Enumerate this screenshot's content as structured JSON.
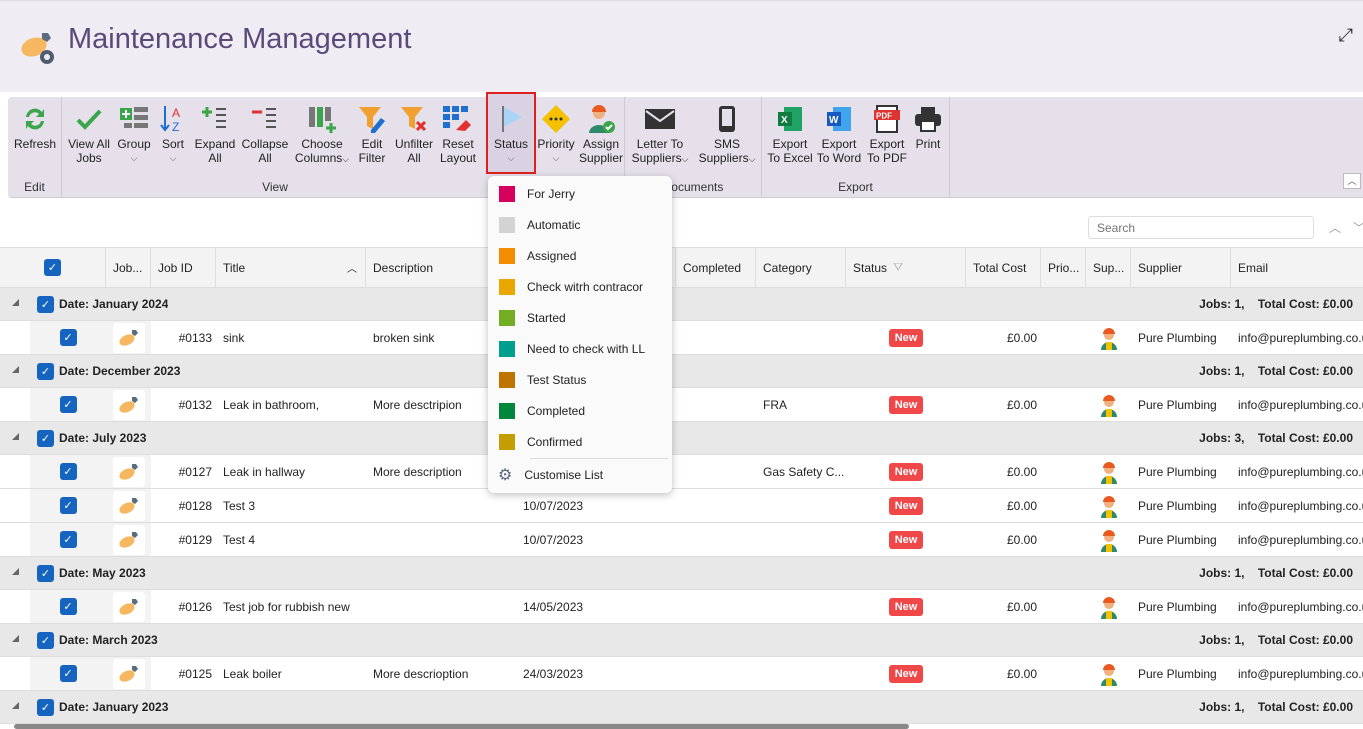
{
  "app": {
    "title": "Maintenance Management"
  },
  "ribbon": {
    "groups": {
      "edit": "Edit",
      "view": "View",
      "documents": "Documents",
      "export": "Export"
    },
    "buttons": {
      "refresh": "Refresh",
      "view_all": [
        "View All",
        "Jobs"
      ],
      "group": "Group",
      "sort": "Sort",
      "expand_all": [
        "Expand",
        "All"
      ],
      "collapse_all": [
        "Collapse",
        "All"
      ],
      "choose_columns": [
        "Choose",
        "Columns"
      ],
      "edit_filter": [
        "Edit",
        "Filter"
      ],
      "unfilter_all": [
        "Unfilter",
        "All"
      ],
      "reset_layout": [
        "Reset",
        "Layout"
      ],
      "status": "Status",
      "priority": "Priority",
      "assign_supplier": [
        "Assign",
        "Supplier"
      ],
      "letter": [
        "Letter To",
        "Suppliers"
      ],
      "sms": [
        "SMS",
        "Suppliers"
      ],
      "excel": [
        "Export",
        "To Excel"
      ],
      "word": [
        "Export",
        "To Word"
      ],
      "pdf": [
        "Export",
        "To PDF"
      ],
      "print": "Print"
    }
  },
  "search": {
    "placeholder": "Search"
  },
  "status_menu": {
    "items": [
      {
        "label": "For Jerry",
        "color": "#d6005f"
      },
      {
        "label": "Automatic",
        "color": "#d3d3d3"
      },
      {
        "label": "Assigned",
        "color": "#f28c00"
      },
      {
        "label": "Check witrh contracor",
        "color": "#e9a700"
      },
      {
        "label": "Started",
        "color": "#73ad24"
      },
      {
        "label": "Need to check with LL",
        "color": "#009e8c"
      },
      {
        "label": "Test Status",
        "color": "#bf7400"
      },
      {
        "label": "Completed",
        "color": "#00873c"
      },
      {
        "label": "Confirmed",
        "color": "#c49d00"
      }
    ],
    "customise": "Customise List"
  },
  "columns": {
    "job_icon": "Job...",
    "job_id": "Job ID",
    "title": "Title",
    "description": "Description",
    "completed": "Completed",
    "category": "Category",
    "status": "Status",
    "total_cost": "Total Cost",
    "priority": "Prio...",
    "supplier_icon": "Sup...",
    "supplier": "Supplier",
    "email": "Email"
  },
  "groups": [
    {
      "label": "Date: January 2024",
      "summary": "Jobs: 1,    Total Cost: £0.00",
      "rows": [
        {
          "id": "#0133",
          "title": "sink",
          "description": "broken sink",
          "date": "",
          "category": "",
          "status": "New",
          "cost": "£0.00",
          "supplier": "Pure Plumbing",
          "email": "info@pureplumbing.co.uk"
        }
      ]
    },
    {
      "label": "Date: December 2023",
      "summary": "Jobs: 1,    Total Cost: £0.00",
      "rows": [
        {
          "id": "#0132",
          "title": "Leak in bathroom,",
          "description": "More desctripion",
          "date": "",
          "category": "FRA",
          "status": "New",
          "cost": "£0.00",
          "supplier": "Pure Plumbing",
          "email": "info@pureplumbing.co.uk"
        }
      ]
    },
    {
      "label": "Date: July 2023",
      "summary": "Jobs: 3,    Total Cost: £0.00",
      "rows": [
        {
          "id": "#0127",
          "title": "Leak in hallway",
          "description": "More description",
          "date": "",
          "category": "Gas Safety C...",
          "status": "New",
          "cost": "£0.00",
          "supplier": "Pure Plumbing",
          "email": "info@pureplumbing.co.uk"
        },
        {
          "id": "#0128",
          "title": "Test 3",
          "description": "",
          "date": "10/07/2023",
          "category": "",
          "status": "New",
          "cost": "£0.00",
          "supplier": "Pure Plumbing",
          "email": "info@pureplumbing.co.uk"
        },
        {
          "id": "#0129",
          "title": "Test 4",
          "description": "",
          "date": "10/07/2023",
          "category": "",
          "status": "New",
          "cost": "£0.00",
          "supplier": "Pure Plumbing",
          "email": "info@pureplumbing.co.uk"
        }
      ]
    },
    {
      "label": "Date: May 2023",
      "summary": "Jobs: 1,    Total Cost: £0.00",
      "rows": [
        {
          "id": "#0126",
          "title": "Test job for rubbish new",
          "description": "",
          "date": "14/05/2023",
          "category": "",
          "status": "New",
          "cost": "£0.00",
          "supplier": "Pure Plumbing",
          "email": "info@pureplumbing.co.uk"
        }
      ]
    },
    {
      "label": "Date: March 2023",
      "summary": "Jobs: 1,    Total Cost: £0.00",
      "rows": [
        {
          "id": "#0125",
          "title": "Leak boiler",
          "description": "More descrioption",
          "date": "24/03/2023",
          "category": "",
          "status": "New",
          "cost": "£0.00",
          "supplier": "Pure Plumbing",
          "email": "info@pureplumbing.co.uk"
        }
      ]
    },
    {
      "label": "Date: January 2023",
      "summary": "Jobs: 1,    Total Cost: £0.00",
      "rows": []
    }
  ]
}
